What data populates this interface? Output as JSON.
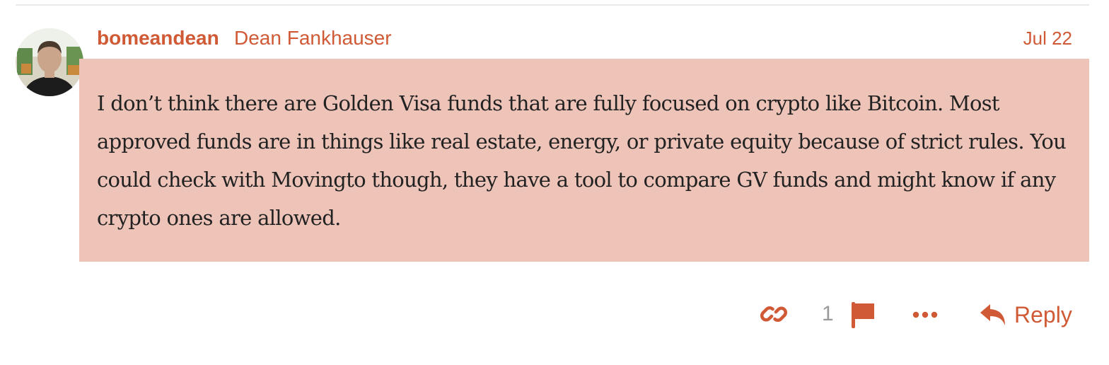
{
  "post": {
    "username": "bomeandean",
    "full_name": "Dean Fankhauser",
    "date": "Jul 22",
    "body": "I don’t think there are Golden Visa funds that are fully focused on crypto like Bitcoin. Most approved funds are in things like real estate, energy, or private equity because of strict rules. You could check with Movingto though, they have a tool to compare GV funds and might know if any crypto ones are allowed."
  },
  "actions": {
    "like_count": "1",
    "reply_label": "Reply",
    "icons": [
      "link-icon",
      "flag-icon",
      "more-icon",
      "reply-icon"
    ]
  },
  "colors": {
    "accent": "#d05a35",
    "highlight_bg": "#eec4b9",
    "text": "#222222",
    "muted": "#9a9a9a"
  }
}
